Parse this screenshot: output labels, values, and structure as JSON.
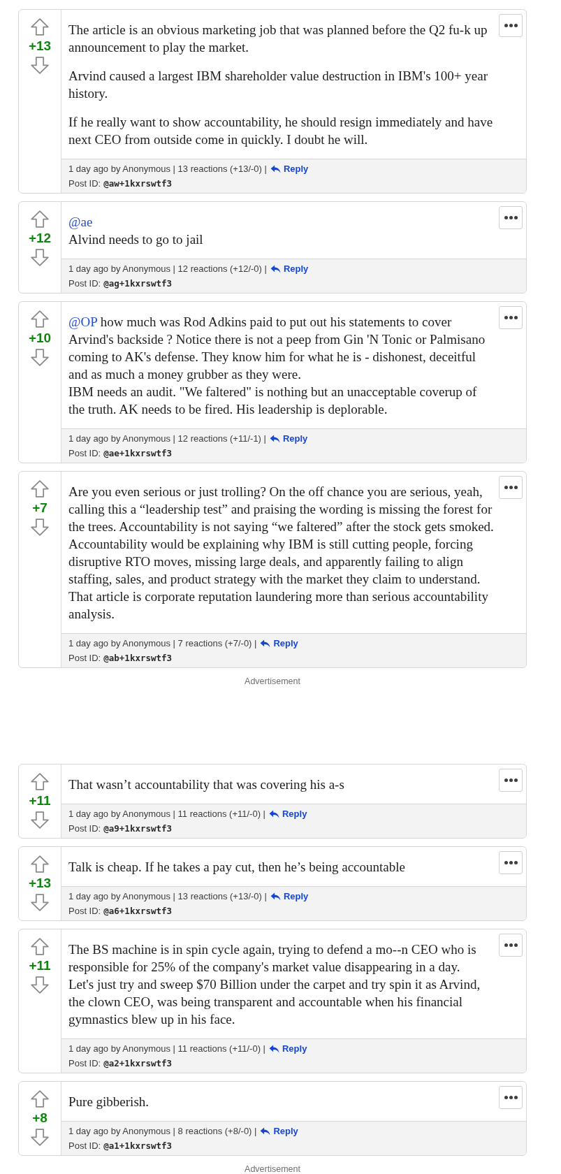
{
  "feed": [
    {
      "kind": "post",
      "score": "+13",
      "body": [
        [
          {
            "kind": "text",
            "text": "The article is an obvious marketing job that was planned before the Q2 fu-k up announcement to play the market."
          }
        ],
        [
          {
            "kind": "text",
            "text": "Arvind caused a largest IBM shareholder value destruction in IBM's 100+ year history."
          }
        ],
        [
          {
            "kind": "text",
            "text": "If he really want to show accountability, he should resign immediately and have next CEO from outside come in quickly. I doubt he will."
          }
        ]
      ],
      "meta": "1 day ago by Anonymous | 13 reactions (+13/-0) |",
      "reply": "Reply",
      "id_label": "Post ID:",
      "post_id": "@aw+1kxrswtf3"
    },
    {
      "kind": "post",
      "score": "+12",
      "body": [
        [
          {
            "kind": "mention",
            "text": "@ae"
          },
          {
            "kind": "break"
          },
          {
            "kind": "text",
            "text": "Alvind needs to go to jail"
          }
        ]
      ],
      "meta": "1 day ago by Anonymous | 12 reactions (+12/-0) |",
      "reply": "Reply",
      "id_label": "Post ID:",
      "post_id": "@ag+1kxrswtf3"
    },
    {
      "kind": "post",
      "score": "+10",
      "body": [
        [
          {
            "kind": "mention",
            "text": "@OP"
          },
          {
            "kind": "text",
            "text": " how much was Rod Adkins paid to put out his statements to cover Arvind's backside ? Notice there is not a peep from Gin 'N Tonic or Palmisano coming to AK's defense. They know him for what he is - dishonest, deceitful and as much a money grubber as they were."
          },
          {
            "kind": "break"
          },
          {
            "kind": "text",
            "text": "IBM needs an audit. \"We faltered\" is nothing but an unacceptable coverup of the truth. AK needs to be fired. His leadership is deplorable."
          }
        ]
      ],
      "meta": "1 day ago by Anonymous | 12 reactions (+11/-1) |",
      "reply": "Reply",
      "id_label": "Post ID:",
      "post_id": "@ae+1kxrswtf3"
    },
    {
      "kind": "post",
      "score": "+7",
      "body": [
        [
          {
            "kind": "text",
            "text": "Are you even serious or just trolling? On the off chance you are serious, yeah, calling this a “leadership test” and praising the wording is missing the forest for the trees. Accountability is not saying “we faltered” after the stock gets smoked. Accountability would be explaining why IBM is still cutting people, forcing disruptive RTO moves, missing large deals, and apparently failing to align staffing, sales, and product strategy with the market they claim to understand. That article is corporate reputation laundering more than serious accountability analysis."
          }
        ]
      ],
      "meta": "1 day ago by Anonymous | 7 reactions (+7/-0) |",
      "reply": "Reply",
      "id_label": "Post ID:",
      "post_id": "@ab+1kxrswtf3"
    },
    {
      "kind": "ad",
      "label": "Advertisement"
    },
    {
      "kind": "post",
      "score": "+11",
      "body": [
        [
          {
            "kind": "text",
            "text": "That wasn’t accountability that was covering his a-s"
          }
        ]
      ],
      "meta": "1 day ago by Anonymous | 11 reactions (+11/-0) |",
      "reply": "Reply",
      "id_label": "Post ID:",
      "post_id": "@a9+1kxrswtf3"
    },
    {
      "kind": "post",
      "score": "+13",
      "body": [
        [
          {
            "kind": "text",
            "text": "Talk is cheap. If he takes a pay cut, then he’s being accountable"
          }
        ]
      ],
      "meta": "1 day ago by Anonymous | 13 reactions (+13/-0) |",
      "reply": "Reply",
      "id_label": "Post ID:",
      "post_id": "@a6+1kxrswtf3"
    },
    {
      "kind": "post",
      "score": "+11",
      "body": [
        [
          {
            "kind": "text",
            "text": "The BS machine is in spin cycle again, trying to defend a mo--n CEO who is responsible for 25% of the company's market value disappearing in a day."
          },
          {
            "kind": "break"
          },
          {
            "kind": "text",
            "text": "Let's just try and sweep $70 Billion under the carpet and try spin it as Arvind, the clown CEO, was being transparent and accountable when his financial gymnastics blew up in his face."
          }
        ]
      ],
      "meta": "1 day ago by Anonymous | 11 reactions (+11/-0) |",
      "reply": "Reply",
      "id_label": "Post ID:",
      "post_id": "@a2+1kxrswtf3"
    },
    {
      "kind": "post",
      "score": "+8",
      "body": [
        [
          {
            "kind": "text",
            "text": "Pure gibberish."
          }
        ]
      ],
      "meta": "1 day ago by Anonymous | 8 reactions (+8/-0) |",
      "reply": "Reply",
      "id_label": "Post ID:",
      "post_id": "@a1+1kxrswtf3"
    },
    {
      "kind": "ad",
      "label": "Advertisement"
    }
  ]
}
